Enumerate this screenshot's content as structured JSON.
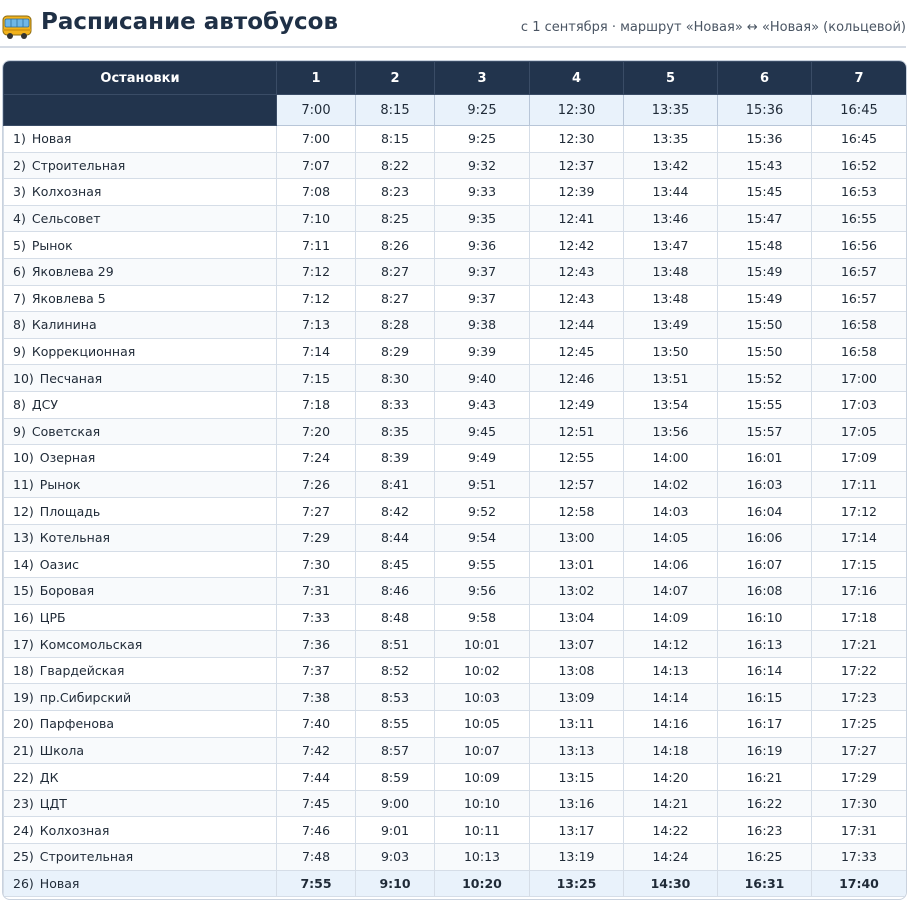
{
  "header": {
    "title": "Расписание автобусов",
    "subtitle": "с 1 сентября · маршрут «Новая» ↔ «Новая» (кольцевой)",
    "icon": "bus-icon"
  },
  "table": {
    "stop_column_label": "Остановки",
    "trip_numbers": [
      "1",
      "2",
      "3",
      "4",
      "5",
      "6",
      "7"
    ],
    "departure_times": [
      "7:00",
      "8:15",
      "9:25",
      "12:30",
      "13:35",
      "15:36",
      "16:45"
    ],
    "rows": [
      {
        "num": "1)",
        "stop": "Новая",
        "times": [
          "7:00",
          "8:15",
          "9:25",
          "12:30",
          "13:35",
          "15:36",
          "16:45"
        ]
      },
      {
        "num": "2)",
        "stop": "Строительная",
        "times": [
          "7:07",
          "8:22",
          "9:32",
          "12:37",
          "13:42",
          "15:43",
          "16:52"
        ]
      },
      {
        "num": "3)",
        "stop": "Колхозная",
        "times": [
          "7:08",
          "8:23",
          "9:33",
          "12:39",
          "13:44",
          "15:45",
          "16:53"
        ]
      },
      {
        "num": "4)",
        "stop": "Сельсовет",
        "times": [
          "7:10",
          "8:25",
          "9:35",
          "12:41",
          "13:46",
          "15:47",
          "16:55"
        ]
      },
      {
        "num": "5)",
        "stop": "Рынок",
        "times": [
          "7:11",
          "8:26",
          "9:36",
          "12:42",
          "13:47",
          "15:48",
          "16:56"
        ]
      },
      {
        "num": "6)",
        "stop": "Яковлева 29",
        "times": [
          "7:12",
          "8:27",
          "9:37",
          "12:43",
          "13:48",
          "15:49",
          "16:57"
        ]
      },
      {
        "num": "7)",
        "stop": "Яковлева 5",
        "times": [
          "7:12",
          "8:27",
          "9:37",
          "12:43",
          "13:48",
          "15:49",
          "16:57"
        ]
      },
      {
        "num": "8)",
        "stop": "Калинина",
        "times": [
          "7:13",
          "8:28",
          "9:38",
          "12:44",
          "13:49",
          "15:50",
          "16:58"
        ]
      },
      {
        "num": "9)",
        "stop": "Коррекционная",
        "times": [
          "7:14",
          "8:29",
          "9:39",
          "12:45",
          "13:50",
          "15:50",
          "16:58"
        ]
      },
      {
        "num": "10)",
        "stop": "Песчаная",
        "times": [
          "7:15",
          "8:30",
          "9:40",
          "12:46",
          "13:51",
          "15:52",
          "17:00"
        ]
      },
      {
        "num": "8)",
        "stop": "ДСУ",
        "times": [
          "7:18",
          "8:33",
          "9:43",
          "12:49",
          "13:54",
          "15:55",
          "17:03"
        ]
      },
      {
        "num": "9)",
        "stop": "Советская",
        "times": [
          "7:20",
          "8:35",
          "9:45",
          "12:51",
          "13:56",
          "15:57",
          "17:05"
        ]
      },
      {
        "num": "10)",
        "stop": "Озерная",
        "times": [
          "7:24",
          "8:39",
          "9:49",
          "12:55",
          "14:00",
          "16:01",
          "17:09"
        ]
      },
      {
        "num": "11)",
        "stop": "Рынок",
        "times": [
          "7:26",
          "8:41",
          "9:51",
          "12:57",
          "14:02",
          "16:03",
          "17:11"
        ]
      },
      {
        "num": "12)",
        "stop": "Площадь",
        "times": [
          "7:27",
          "8:42",
          "9:52",
          "12:58",
          "14:03",
          "16:04",
          "17:12"
        ]
      },
      {
        "num": "13)",
        "stop": "Котельная",
        "times": [
          "7:29",
          "8:44",
          "9:54",
          "13:00",
          "14:05",
          "16:06",
          "17:14"
        ]
      },
      {
        "num": "14)",
        "stop": "Оазис",
        "times": [
          "7:30",
          "8:45",
          "9:55",
          "13:01",
          "14:06",
          "16:07",
          "17:15"
        ]
      },
      {
        "num": "15)",
        "stop": "Боровая",
        "times": [
          "7:31",
          "8:46",
          "9:56",
          "13:02",
          "14:07",
          "16:08",
          "17:16"
        ]
      },
      {
        "num": "16)",
        "stop": "ЦРБ",
        "times": [
          "7:33",
          "8:48",
          "9:58",
          "13:04",
          "14:09",
          "16:10",
          "17:18"
        ]
      },
      {
        "num": "17)",
        "stop": "Комсомольская",
        "times": [
          "7:36",
          "8:51",
          "10:01",
          "13:07",
          "14:12",
          "16:13",
          "17:21"
        ]
      },
      {
        "num": "18)",
        "stop": "Гвардейская",
        "times": [
          "7:37",
          "8:52",
          "10:02",
          "13:08",
          "14:13",
          "16:14",
          "17:22"
        ]
      },
      {
        "num": "19)",
        "stop": "пр.Сибирский",
        "times": [
          "7:38",
          "8:53",
          "10:03",
          "13:09",
          "14:14",
          "16:15",
          "17:23"
        ]
      },
      {
        "num": "20)",
        "stop": "Парфенова",
        "times": [
          "7:40",
          "8:55",
          "10:05",
          "13:11",
          "14:16",
          "16:17",
          "17:25"
        ]
      },
      {
        "num": "21)",
        "stop": "Школа",
        "times": [
          "7:42",
          "8:57",
          "10:07",
          "13:13",
          "14:18",
          "16:19",
          "17:27"
        ]
      },
      {
        "num": "22)",
        "stop": "ДК",
        "times": [
          "7:44",
          "8:59",
          "10:09",
          "13:15",
          "14:20",
          "16:21",
          "17:29"
        ]
      },
      {
        "num": "23)",
        "stop": "ЦДТ",
        "times": [
          "7:45",
          "9:00",
          "10:10",
          "13:16",
          "14:21",
          "16:22",
          "17:30"
        ]
      },
      {
        "num": "24)",
        "stop": "Колхозная",
        "times": [
          "7:46",
          "9:01",
          "10:11",
          "13:17",
          "14:22",
          "16:23",
          "17:31"
        ]
      },
      {
        "num": "25)",
        "stop": "Строительная",
        "times": [
          "7:48",
          "9:03",
          "10:13",
          "13:19",
          "14:24",
          "16:25",
          "17:33"
        ]
      },
      {
        "num": "26)",
        "stop": "Новая",
        "times": [
          "7:55",
          "9:10",
          "10:20",
          "13:25",
          "14:30",
          "16:31",
          "17:40"
        ]
      }
    ]
  }
}
